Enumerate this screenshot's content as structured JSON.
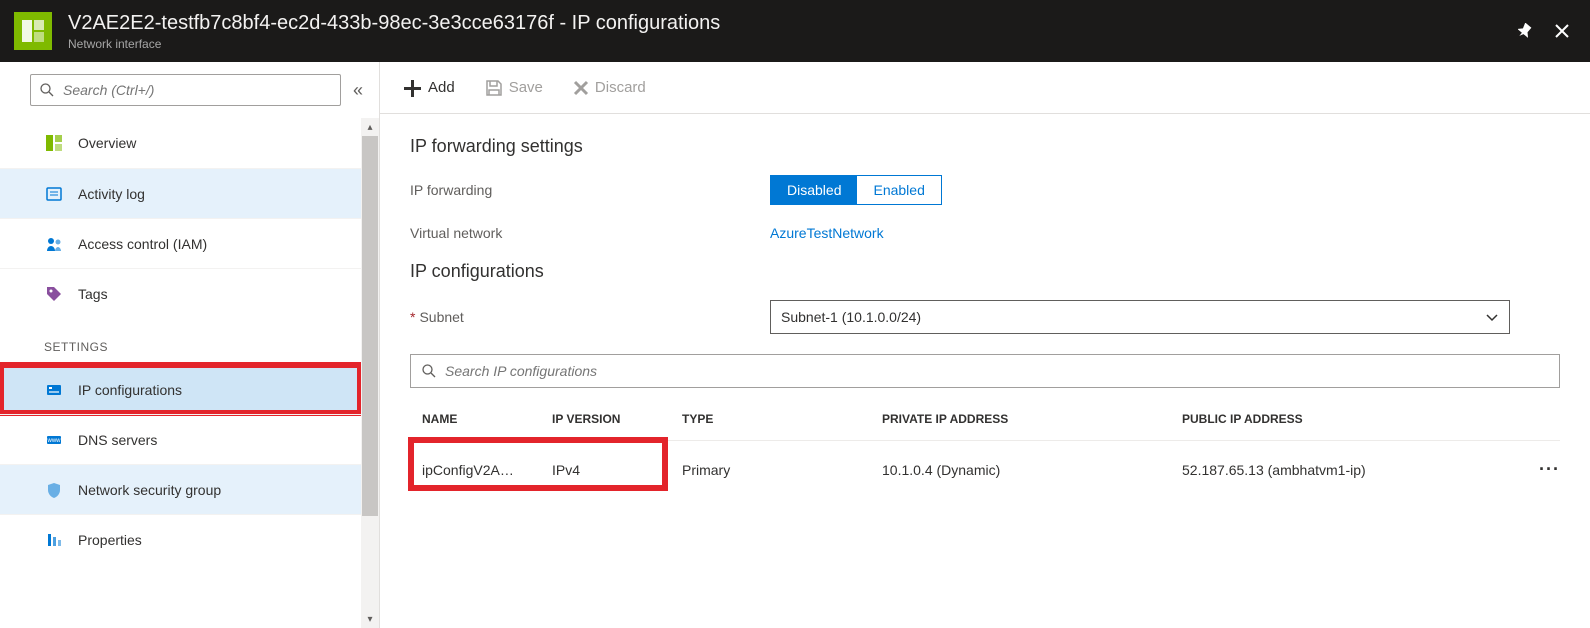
{
  "header": {
    "title": "V2AE2E2-testfb7c8bf4-ec2d-433b-98ec-3e3cce63176f - IP configurations",
    "subtitle": "Network interface"
  },
  "sidebar": {
    "search_placeholder": "Search (Ctrl+/)",
    "items_top": [
      {
        "icon": "#7fba00",
        "label": "Overview",
        "iconType": "overview"
      },
      {
        "icon": "#0078d4",
        "label": "Activity log",
        "iconType": "activitylog",
        "state": "hover"
      },
      {
        "icon": "#0078d4",
        "label": "Access control (IAM)",
        "iconType": "iam"
      },
      {
        "icon": "#894f9e",
        "label": "Tags",
        "iconType": "tag"
      }
    ],
    "section_label": "SETTINGS",
    "items_settings": [
      {
        "icon": "#0078d4",
        "label": "IP configurations",
        "iconType": "ipconfig",
        "state": "selected",
        "highlight": true
      },
      {
        "icon": "#0078d4",
        "label": "DNS servers",
        "iconType": "dns"
      },
      {
        "icon": "#69afe5",
        "label": "Network security group",
        "iconType": "nsg",
        "state": "hover"
      },
      {
        "icon": "#0078d4",
        "label": "Properties",
        "iconType": "props"
      }
    ]
  },
  "toolbar": {
    "add": "Add",
    "save": "Save",
    "discard": "Discard"
  },
  "content": {
    "section1_title": "IP forwarding settings",
    "ipfw_label": "IP forwarding",
    "ipfw_options": [
      "Disabled",
      "Enabled"
    ],
    "ipfw_active": "Disabled",
    "vnet_label": "Virtual network",
    "vnet_value": "AzureTestNetwork",
    "section2_title": "IP configurations",
    "subnet_label": "Subnet",
    "subnet_value": "Subnet-1 (10.1.0.0/24)",
    "search_placeholder": "Search IP configurations",
    "columns": [
      "NAME",
      "IP VERSION",
      "TYPE",
      "PRIVATE IP ADDRESS",
      "PUBLIC IP ADDRESS"
    ],
    "rows": [
      {
        "name": "ipConfigV2A…",
        "version": "IPv4",
        "type": "Primary",
        "private": "10.1.0.4 (Dynamic)",
        "public": "52.187.65.13 (ambhatvm1-ip)"
      }
    ]
  }
}
